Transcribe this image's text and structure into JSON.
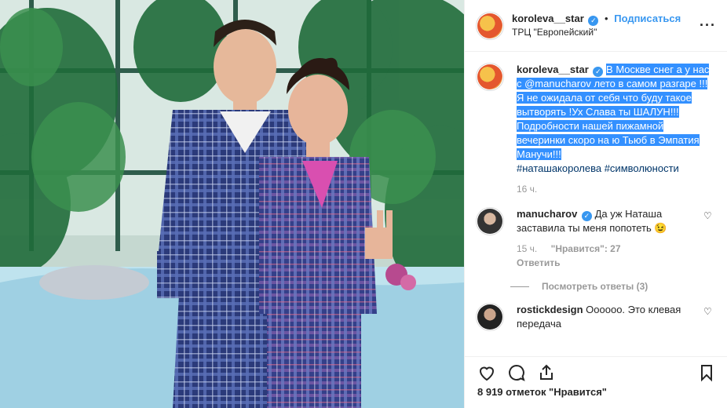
{
  "header": {
    "username": "koroleva__star",
    "separator": "•",
    "follow_label": "Подписаться",
    "location": "ТРЦ \"Европейский\"",
    "more_label": "···"
  },
  "caption": {
    "username": "koroleva__star",
    "text": "В Москве снег а у нас с @manucharov лето в самом разгаре !!!Я не ожидала от себя что буду такое вытворять !Ух Слава ты ШАЛУН!!! Подробности нашей пижамной вечеринки скоро на ю Тьюб в Эмпатия Манучи!!!",
    "hashtags": "#наташакоролева #символюности",
    "time": "16 ч."
  },
  "comments": [
    {
      "username": "manucharov",
      "text": "Да уж Наташа заставила ты меня попотеть 😉",
      "time": "15 ч.",
      "likes": "\"Нравится\": 27",
      "reply_label": "Ответить",
      "view_replies": "Посмотреть ответы (3)"
    },
    {
      "username": "rostickdesign",
      "text": "Оооооо. Это клевая передача"
    }
  ],
  "footer": {
    "likes_text": "8 919 отметок \"Нравится\""
  },
  "colors": {
    "accent": "#3897f0",
    "highlight": "#3390ff",
    "hashtag": "#003569"
  },
  "icons": [
    "heart-icon",
    "comment-icon",
    "share-icon",
    "bookmark-icon",
    "verified-icon",
    "more-icon"
  ]
}
